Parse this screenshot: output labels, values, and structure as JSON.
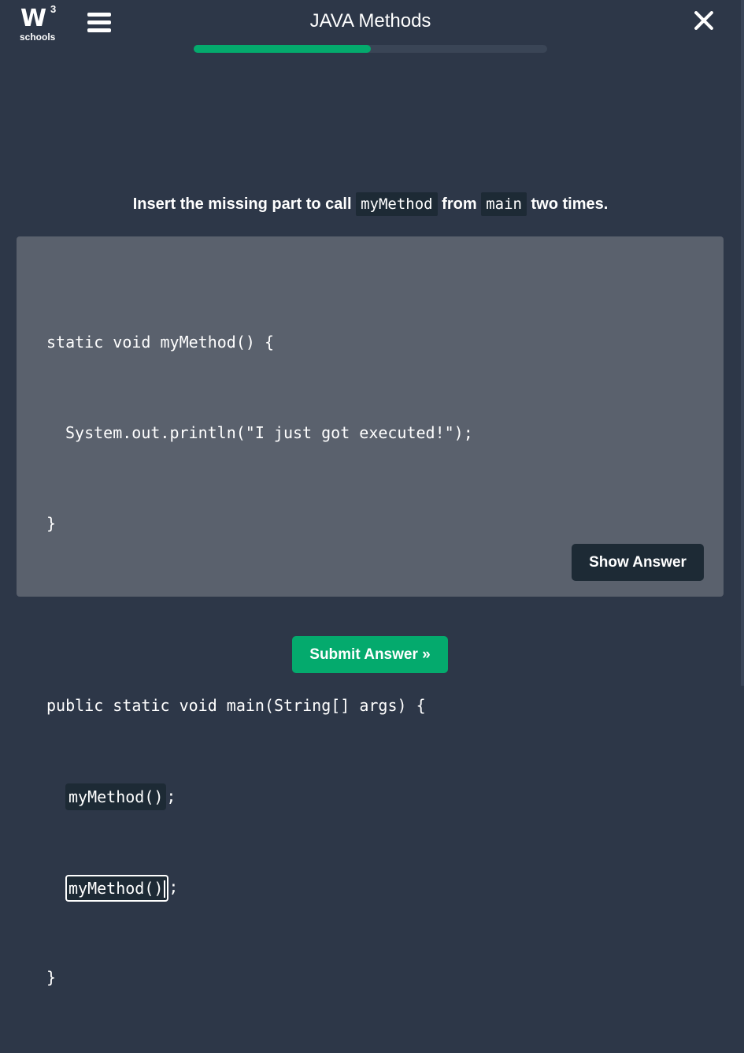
{
  "header": {
    "logo_mark": "W",
    "logo_superscript": "3",
    "logo_text": "schools",
    "title": "JAVA Methods",
    "menu_icon": "hamburger-menu-icon",
    "close_icon": "close-icon",
    "progress_fraction": 0.5
  },
  "question": {
    "text_before": "Insert the missing part to call",
    "code_1": "myMethod",
    "text_middle": "from",
    "code_2": "main",
    "text_after": "two times."
  },
  "code_lines": {
    "l1": "static void myMethod() {",
    "l2": "System.out.println(\"I just got executed!\");",
    "l3": "}",
    "l5": "public static void main(String[] args) {",
    "l6_suffix": ";",
    "l7_suffix": ";",
    "l8": "}"
  },
  "answers": {
    "first_value": "myMethod()",
    "second_value": "myMethod()"
  },
  "buttons": {
    "show_answer": "Show Answer",
    "submit": "Submit Answer »"
  },
  "colors": {
    "background": "#2d3748",
    "accent": "#04aa6d",
    "code_panel": "#5a616d",
    "dark_box": "#1d2a35"
  }
}
